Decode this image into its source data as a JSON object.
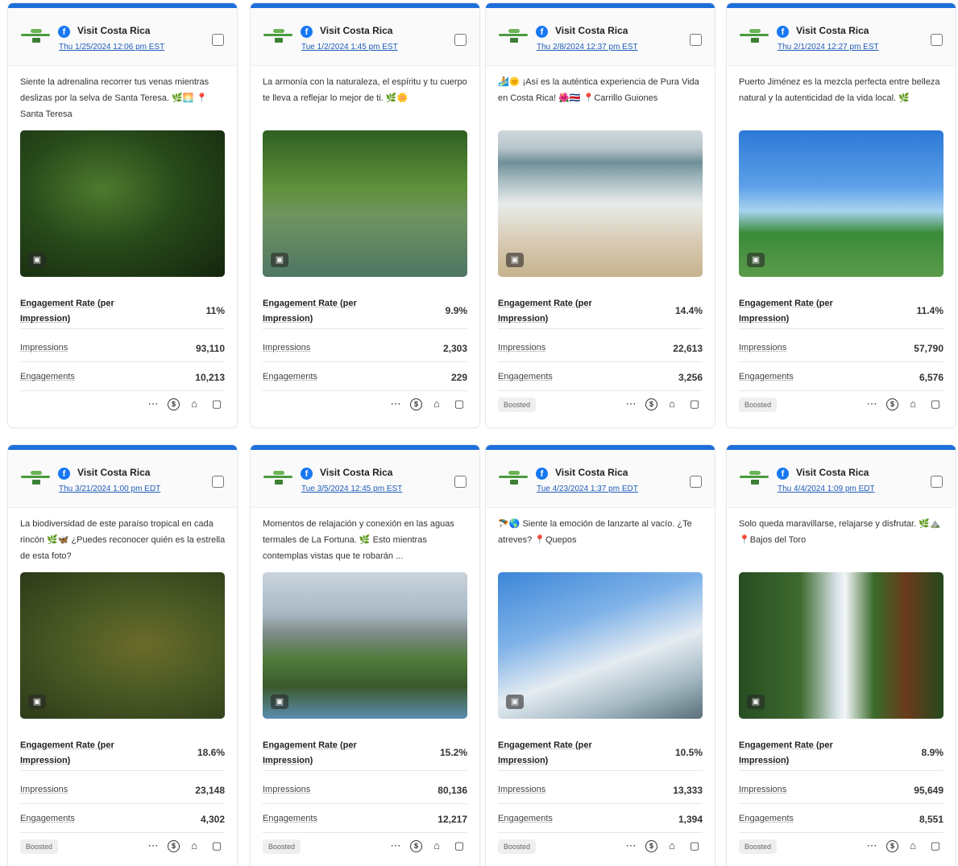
{
  "posts": [
    {
      "account": "Visit Costa Rica",
      "date": "Thu 1/25/2024 12:06 pm EST",
      "caption": "Siente la adrenalina recorrer tus venas mientras deslizas por la selva de Santa Teresa. 🌿🌅 📍Santa Teresa",
      "photo_style": "ph-jungle",
      "engagement_rate_label": "Engagement Rate (per Impression)",
      "engagement_rate": "11%",
      "impressions_label": "Impressions",
      "impressions": "93,110",
      "engagements_label": "Engagements",
      "engagements": "10,213",
      "boosted": ""
    },
    {
      "account": "Visit Costa Rica",
      "date": "Tue 1/2/2024 1:45 pm EST",
      "caption": "La armonía con la naturaleza, el espíritu y tu cuerpo te lleva a reflejar lo mejor de ti. 🌿🌼",
      "photo_style": "ph-pool",
      "engagement_rate_label": "Engagement Rate (per Impression)",
      "engagement_rate": "9.9%",
      "impressions_label": "Impressions",
      "impressions": "2,303",
      "engagements_label": "Engagements",
      "engagements": "229",
      "boosted": ""
    },
    {
      "account": "Visit Costa Rica",
      "date": "Thu 2/8/2024 12:37 pm EST",
      "caption": "🏄🌞 ¡Así es la auténtica experiencia de Pura Vida en Costa Rica! 🌺🇨🇷 📍Carrillo Guiones",
      "photo_style": "ph-beach",
      "engagement_rate_label": "Engagement Rate (per Impression)",
      "engagement_rate": "14.4%",
      "impressions_label": "Impressions",
      "impressions": "22,613",
      "engagements_label": "Engagements",
      "engagements": "3,256",
      "boosted": "Boosted"
    },
    {
      "account": "Visit Costa Rica",
      "date": "Thu 2/1/2024 12:27 pm EST",
      "caption": "Puerto Jiménez es la mezcla perfecta entre belleza natural y la autenticidad de la vida local. 🌿",
      "photo_style": "ph-church",
      "engagement_rate_label": "Engagement Rate (per Impression)",
      "engagement_rate": "11.4%",
      "impressions_label": "Impressions",
      "impressions": "57,790",
      "engagements_label": "Engagements",
      "engagements": "6,576",
      "boosted": "Boosted"
    },
    {
      "account": "Visit Costa Rica",
      "date": "Thu 3/21/2024 1:00 pm EDT",
      "caption": "La biodiversidad de este paraíso tropical en cada rincón 🌿🦋 ¿Puedes reconocer quién es la estrella de esta foto?",
      "photo_style": "ph-bird",
      "engagement_rate_label": "Engagement Rate (per Impression)",
      "engagement_rate": "18.6%",
      "impressions_label": "Impressions",
      "impressions": "23,148",
      "engagements_label": "Engagements",
      "engagements": "4,302",
      "boosted": "Boosted"
    },
    {
      "account": "Visit Costa Rica",
      "date": "Tue 3/5/2024 12:45 pm EST",
      "caption": "Momentos de relajación y conexión en las aguas termales de La Fortuna. 🌿 Esto mientras contemplas vistas que te robarán ...",
      "photo_style": "ph-volcano",
      "engagement_rate_label": "Engagement Rate (per Impression)",
      "engagement_rate": "15.2%",
      "impressions_label": "Impressions",
      "impressions": "80,136",
      "engagements_label": "Engagements",
      "engagements": "12,217",
      "boosted": "Boosted"
    },
    {
      "account": "Visit Costa Rica",
      "date": "Tue 4/23/2024 1:37 pm EDT",
      "caption": "🪂🌎 Siente la emoción de lanzarte al vacío. ¿Te atreves? 📍Quepos",
      "photo_style": "ph-sky",
      "engagement_rate_label": "Engagement Rate (per Impression)",
      "engagement_rate": "10.5%",
      "impressions_label": "Impressions",
      "impressions": "13,333",
      "engagements_label": "Engagements",
      "engagements": "1,394",
      "boosted": "Boosted"
    },
    {
      "account": "Visit Costa Rica",
      "date": "Thu 4/4/2024 1:09 pm EDT",
      "caption": "Solo queda maravillarse, relajarse y disfrutar. 🌿⛰️ 📍Bajos del Toro",
      "photo_style": "ph-falls",
      "engagement_rate_label": "Engagement Rate (per Impression)",
      "engagement_rate": "8.9%",
      "impressions_label": "Impressions",
      "impressions": "95,649",
      "engagements_label": "Engagements",
      "engagements": "8,551",
      "boosted": "Boosted"
    }
  ],
  "icons": {
    "facebook": "facebook-icon",
    "image": "image-icon",
    "more": "more-icon",
    "dollar": "dollar-icon",
    "tag": "tag-icon",
    "comment": "comment-icon"
  },
  "colors": {
    "accent_bar": "#1e6fd9",
    "facebook": "#1877f2",
    "link": "#1e5bb8"
  }
}
